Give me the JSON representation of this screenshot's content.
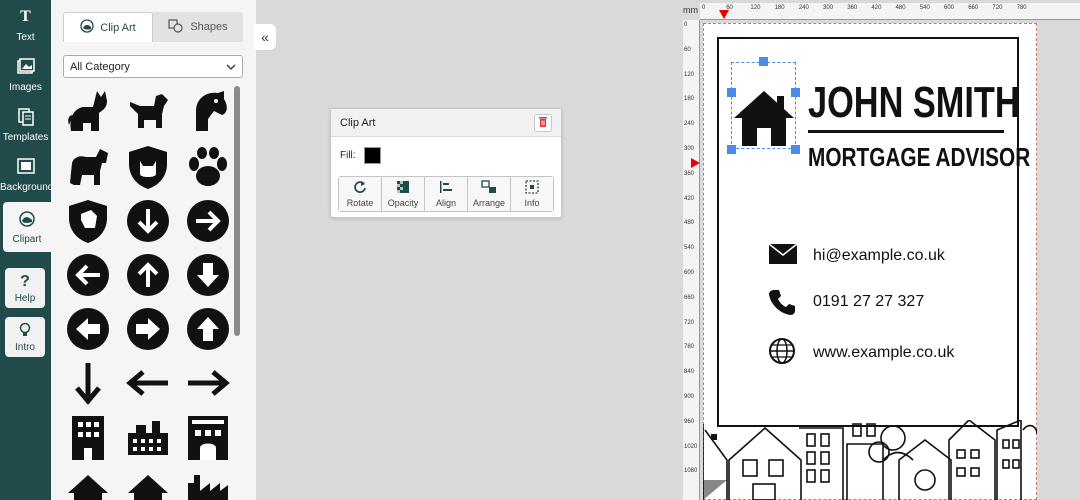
{
  "rail": {
    "text": "Text",
    "images": "Images",
    "templates": "Templates",
    "background": "Background",
    "clipart": "Clipart",
    "help": "Help",
    "intro": "Intro"
  },
  "panel": {
    "tab_clipart": "Clip Art",
    "tab_shapes": "Shapes",
    "category": "All Category",
    "icons": [
      "cat",
      "dog",
      "horse-head",
      "horse",
      "cat-shield",
      "paw",
      "dog-shield",
      "arrow-circle-down",
      "arrow-circle-right",
      "arrow-circle-left",
      "arrow-circle-up",
      "arrow-circle-down",
      "arrow-circle-left-bold",
      "arrow-circle-right-bold",
      "arrow-circle-up-bold",
      "arrow-down",
      "arrow-left",
      "arrow-right",
      "building",
      "industry",
      "hotel",
      "house",
      "house",
      "factory"
    ]
  },
  "float": {
    "title": "Clip Art",
    "fill_label": "Fill:",
    "fill_color": "#000000",
    "tools": [
      "Rotate",
      "Opacity",
      "Align",
      "Arrange",
      "Info"
    ]
  },
  "ruler": {
    "unit": "mm",
    "top": [
      "0",
      "60",
      "120",
      "180",
      "240",
      "300",
      "360",
      "420",
      "480",
      "540",
      "600",
      "660",
      "720",
      "780"
    ],
    "left": [
      "0",
      "60",
      "120",
      "180",
      "240",
      "300",
      "360",
      "420",
      "480",
      "540",
      "600",
      "660",
      "720",
      "780",
      "840",
      "900",
      "960",
      "1020",
      "1080"
    ]
  },
  "card": {
    "name": "JOHN SMITH",
    "role": "MORTGAGE ADVISOR",
    "email": "hi@example.co.uk",
    "phone": "0191 27 27 327",
    "web": "www.example.co.uk"
  }
}
